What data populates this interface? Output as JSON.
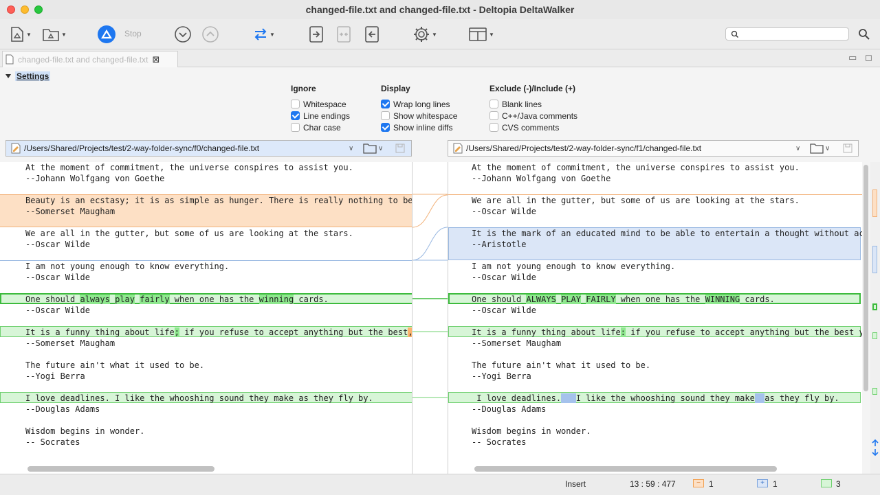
{
  "window": {
    "title": "changed-file.txt and changed-file.txt - Deltopia DeltaWalker"
  },
  "toolbar": {
    "stop_label": "Stop",
    "search_placeholder": "",
    "icons": [
      "new-compare-icon",
      "open-folder-icon",
      "compare-logo-icon",
      "next-diff-icon",
      "prev-diff-icon",
      "swap-icon",
      "copy-right-icon",
      "merge-icon",
      "copy-left-icon",
      "gear-icon",
      "layout-icon",
      "search-icon"
    ]
  },
  "tab": {
    "label": "changed-file.txt and changed-file.txt"
  },
  "settings": {
    "label": "Settings",
    "ignore": {
      "title": "Ignore",
      "options": [
        {
          "label": "Whitespace",
          "checked": false
        },
        {
          "label": "Line endings",
          "checked": true
        },
        {
          "label": "Char case",
          "checked": false
        }
      ]
    },
    "display": {
      "title": "Display",
      "options": [
        {
          "label": "Wrap long lines",
          "checked": true
        },
        {
          "label": "Show whitespace",
          "checked": false
        },
        {
          "label": "Show inline diffs",
          "checked": true
        }
      ]
    },
    "exclude": {
      "title": "Exclude (-)/Include (+)",
      "options": [
        {
          "label": "Blank lines",
          "checked": false
        },
        {
          "label": "C++/Java comments",
          "checked": false
        },
        {
          "label": "CVS comments",
          "checked": false
        }
      ]
    }
  },
  "left": {
    "path": "/Users/Shared/Projects/test/2-way-folder-sync/f0/changed-file.txt",
    "lines": [
      "At the moment of commitment, the universe conspires to assist you.",
      "--Johann Wolfgang von Goethe",
      "",
      "Beauty is an ecstasy; it is as simple as hunger. There is really nothing to be s",
      "--Somerset Maugham",
      "",
      "We are all in the gutter, but some of us are looking at the stars.",
      "--Oscar Wilde",
      "",
      "I am not young enough to know everything.",
      "--Oscar Wilde",
      "",
      "One should always play fairly when one has the winning cards.",
      "--Oscar Wilde",
      "",
      "It is a funny thing about life; if you refuse to accept anything but the best, y",
      "--Somerset Maugham",
      "",
      "The future ain't what it used to be.",
      "--Yogi Berra",
      "",
      "I love deadlines. I like the whooshing sound they make as they fly by.",
      "--Douglas Adams",
      "",
      "Wisdom begins in wonder.",
      "-- Socrates"
    ]
  },
  "right": {
    "path": "/Users/Shared/Projects/test/2-way-folder-sync/f1/changed-file.txt",
    "lines": [
      "At the moment of commitment, the universe conspires to assist you.",
      "--Johann Wolfgang von Goethe",
      "",
      "We are all in the gutter, but some of us are looking at the stars.",
      "--Oscar Wilde",
      "",
      "It is the mark of an educated mind to be able to entertain a thought without acc",
      "--Aristotle",
      "",
      "I am not young enough to know everything.",
      "--Oscar Wilde",
      "",
      "One should ALWAYS PLAY FAIRLY when one has the WINNING cards.",
      "--Oscar Wilde",
      "",
      "It is a funny thing about life: if you refuse to accept anything but the best yc",
      "--Somerset Maugham",
      "",
      "The future ain't what it used to be.",
      "--Yogi Berra",
      "",
      " I love deadlines.   I like the whooshing sound they make  as they fly by.",
      "--Douglas Adams",
      "",
      "Wisdom begins in wonder.",
      "-- Socrates"
    ]
  },
  "status": {
    "mode": "Insert",
    "position": "13 : 59 : 477",
    "removed_count": "1",
    "added_count": "1",
    "changed_count": "3"
  },
  "colors": {
    "removed": "#fde0c5",
    "added": "#dbe6f7",
    "changed": "#d7f5d7",
    "inline_changed": "#8ee88e",
    "inline_removed": "#fdb46c",
    "inline_added": "#a5c2ec"
  }
}
